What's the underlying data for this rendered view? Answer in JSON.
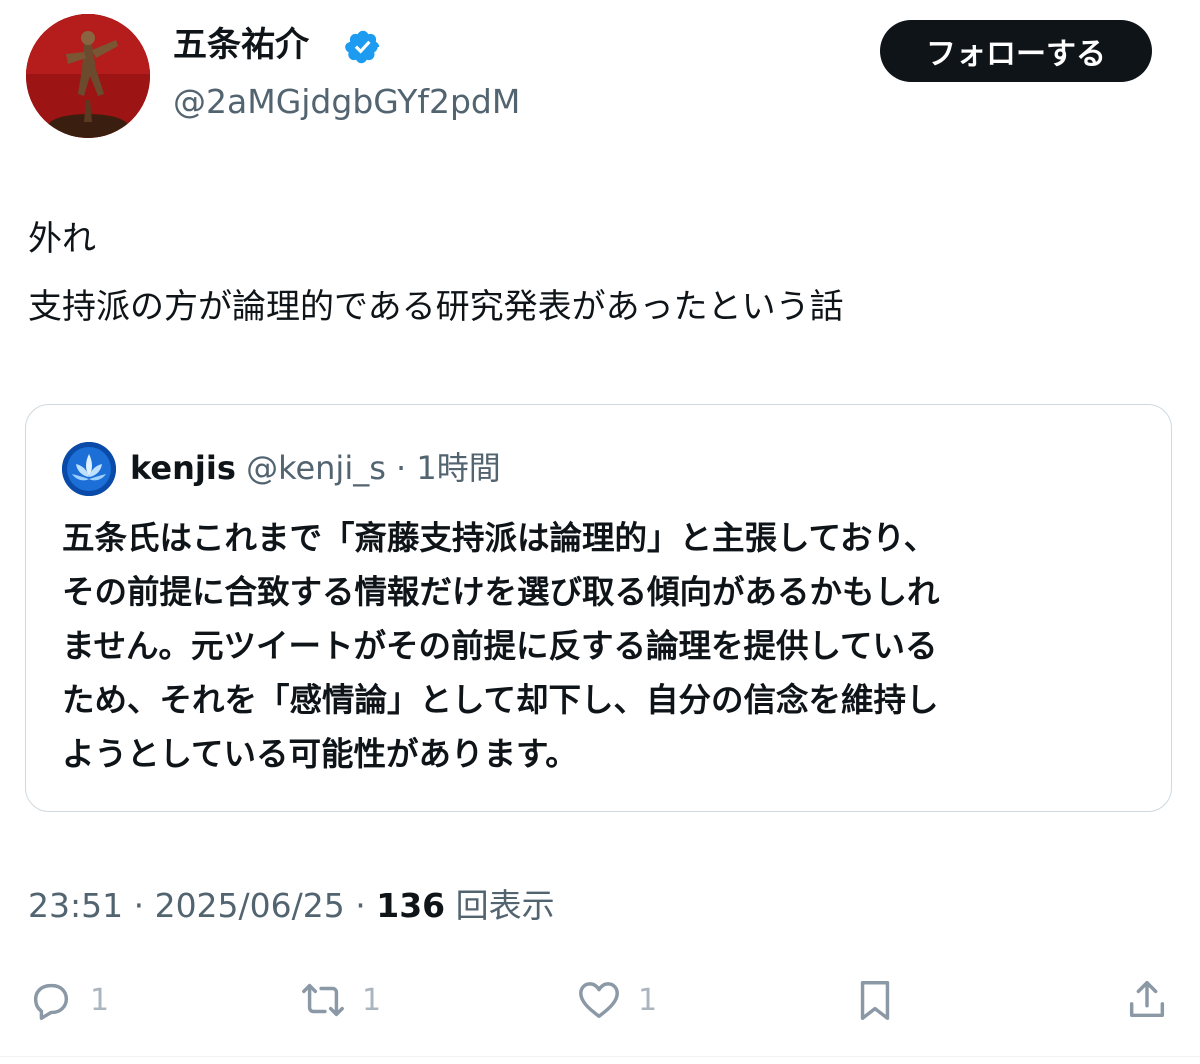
{
  "author": {
    "display_name": "五条祐介",
    "handle": "@2aMGjdgbGYf2pdM",
    "verified_icon": "verified-badge-icon",
    "verified_color": "#1d9bf0"
  },
  "follow_button": {
    "label": "フォローする"
  },
  "tweet": {
    "lines": [
      "外れ",
      "支持派の方が論理的である研究発表があったという話"
    ]
  },
  "quote": {
    "name": "kenjis",
    "handle_time": "@kenji_s · 1時間",
    "lines": [
      "五条氏はこれまで「斎藤支持派は論理的」と主張しており、",
      "その前提に合致する情報だけを選び取る傾向があるかもしれ",
      "ません。元ツイートがその前提に反する論理を提供している",
      "ため、それを「感情論」として却下し、自分の信念を維持し",
      "ようとしている可能性があります。"
    ]
  },
  "meta": {
    "time_date": "23:51 · 2025/06/25 · ",
    "views_count": "136",
    "views_label": " 回表示"
  },
  "actions": {
    "reply_count": "1",
    "retweet_count": "1",
    "like_count": "1"
  },
  "colors": {
    "text": "#0f1419",
    "secondary": "#536471",
    "border": "#cfd9de",
    "action": "#8b98a5"
  }
}
